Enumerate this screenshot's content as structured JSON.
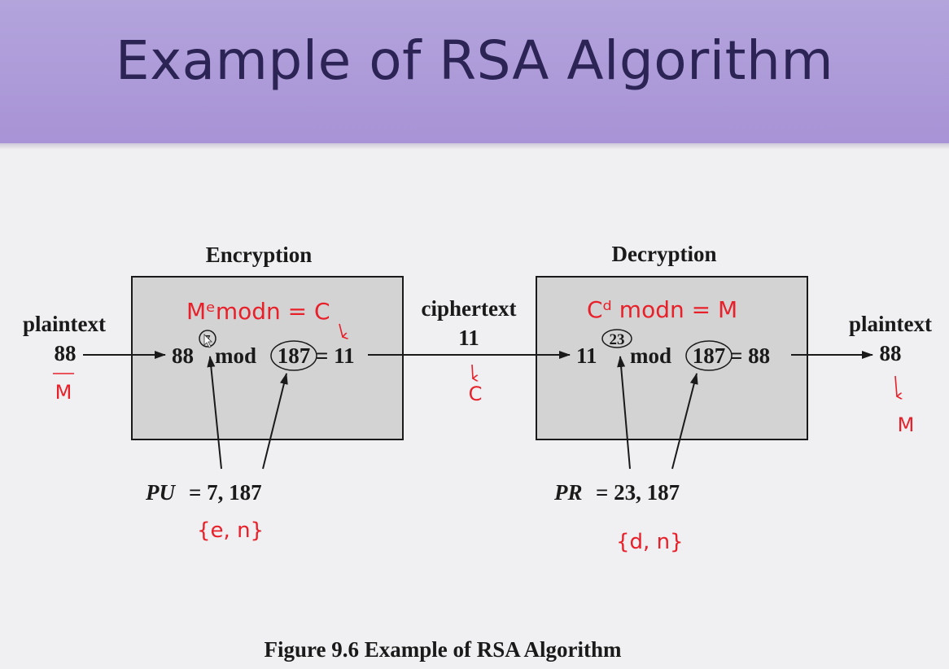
{
  "slide": {
    "title": "Example of RSA Algorithm"
  },
  "figure": {
    "caption": "Figure 9.6  Example of RSA Algorithm",
    "left_input": {
      "label": "plaintext",
      "value": "88"
    },
    "encryption": {
      "heading": "Encryption",
      "base": "88",
      "exponent": "7",
      "mod_word": "mod",
      "modulus": "187",
      "result": "= 11",
      "key_label": "PU",
      "key_value": "= 7, 187"
    },
    "ciphertext": {
      "label": "ciphertext",
      "value": "11"
    },
    "decryption": {
      "heading": "Decryption",
      "base": "11",
      "exponent": "23",
      "mod_word": "mod",
      "modulus": "187",
      "result": "= 88",
      "key_label": "PR",
      "key_value": "= 23, 187"
    },
    "right_output": {
      "label": "plaintext",
      "value": "88"
    }
  },
  "annotations": {
    "enc_formula": "Mᵉmodn = C",
    "dec_formula": "Cᵈ modn = M",
    "plaintext_symbol": "M",
    "cipher_symbol": "C",
    "output_symbol": "M",
    "pu_pair": "{e, n}",
    "pr_pair": "{d, n}"
  },
  "colors": {
    "header": "#a996d8",
    "title_text": "#2c2454",
    "box_fill": "#d3d3d3",
    "annotation_ink": "#e8202a"
  }
}
